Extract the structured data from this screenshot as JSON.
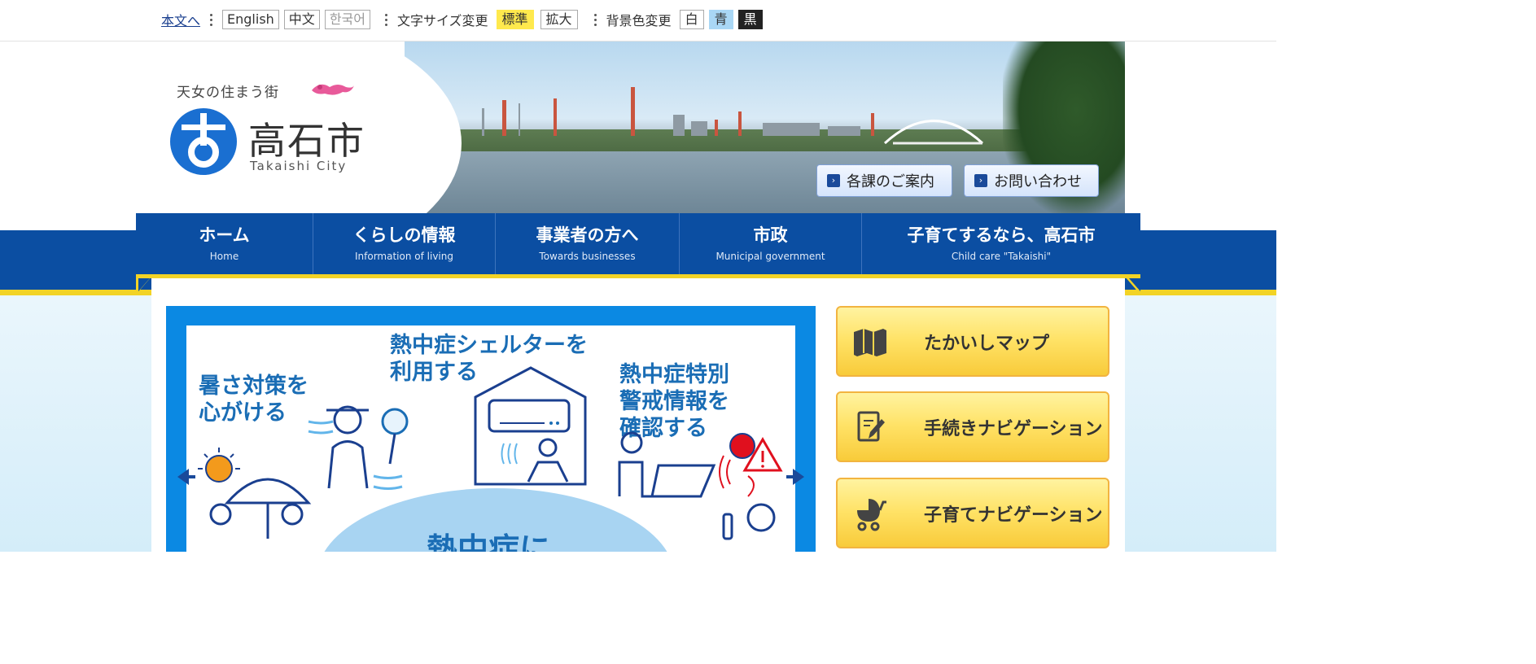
{
  "util": {
    "skip_link": "本文へ",
    "languages": [
      "English",
      "中文",
      "한국어"
    ],
    "font_size_label": "文字サイズ変更",
    "font_sizes": [
      "標準",
      "拡大"
    ],
    "bg_color_label": "背景色変更",
    "bg_colors": [
      "白",
      "青",
      "黒"
    ]
  },
  "header": {
    "tagline": "天女の住まう街",
    "city_name": "高石市",
    "city_name_en": "Takaishi City",
    "buttons": [
      "各課のご案内",
      "お問い合わせ"
    ]
  },
  "nav": [
    {
      "jp": "ホーム",
      "en": "Home"
    },
    {
      "jp": "くらしの情報",
      "en": "Information of living"
    },
    {
      "jp": "事業者の方へ",
      "en": "Towards businesses"
    },
    {
      "jp": "市政",
      "en": "Municipal government"
    },
    {
      "jp": "子育てするなら、高石市",
      "en": "Child care \"Takaishi\""
    }
  ],
  "slide": {
    "text1": "暑さ対策を\n心がける",
    "text2": "熱中症シェルターを\n利用する",
    "text3": "熱中症特別\n警戒情報を\n確認する",
    "text_center": "熱中症に"
  },
  "side_buttons": [
    {
      "label": "たかいしマップ",
      "icon": "map-icon"
    },
    {
      "label": "手続きナビゲーション",
      "icon": "pen-document-icon"
    },
    {
      "label": "子育てナビゲーション",
      "icon": "stroller-icon"
    }
  ],
  "colors": {
    "brand_blue": "#0b4ea2",
    "accent_yellow": "#f2d326",
    "slider_blue": "#0b89e3"
  }
}
